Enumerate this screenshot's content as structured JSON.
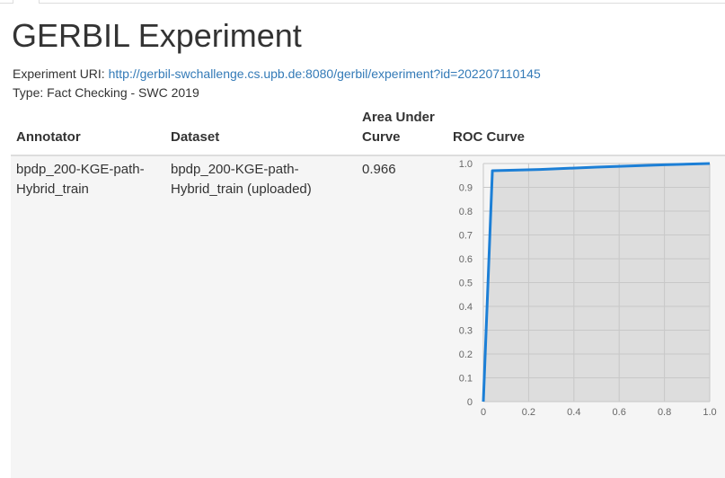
{
  "page": {
    "title": "GERBIL Experiment",
    "uri_label": "Experiment URI: ",
    "uri": "http://gerbil-swchallenge.cs.upb.de:8080/gerbil/experiment?id=202207110145",
    "type_line": "Type: Fact Checking - SWC 2019"
  },
  "table": {
    "headers": [
      "Annotator",
      "Dataset",
      "Area Under Curve",
      "ROC Curve"
    ],
    "rows": [
      {
        "annotator": "bpdp_200-KGE-path-Hybrid_train",
        "dataset": "bpdp_200-KGE-path-Hybrid_train (uploaded)",
        "auc": "0.966"
      }
    ]
  },
  "chart_data": {
    "type": "line",
    "series": [
      {
        "x": [
          0,
          0.04,
          0.25,
          0.5,
          0.8,
          1.0
        ],
        "y": [
          0,
          0.97,
          0.975,
          0.985,
          0.995,
          1.0
        ]
      }
    ],
    "x_ticks": [
      "0",
      "0.2",
      "0.4",
      "0.6",
      "0.8",
      "1.0"
    ],
    "y_ticks": [
      "0",
      "0.1",
      "0.2",
      "0.3",
      "0.4",
      "0.5",
      "0.6",
      "0.7",
      "0.8",
      "0.9",
      "1.0"
    ],
    "xlim": [
      0,
      1
    ],
    "ylim": [
      0,
      1
    ],
    "grid": true,
    "line_color": "#1c7fd6",
    "area_color": "#dddddd"
  }
}
